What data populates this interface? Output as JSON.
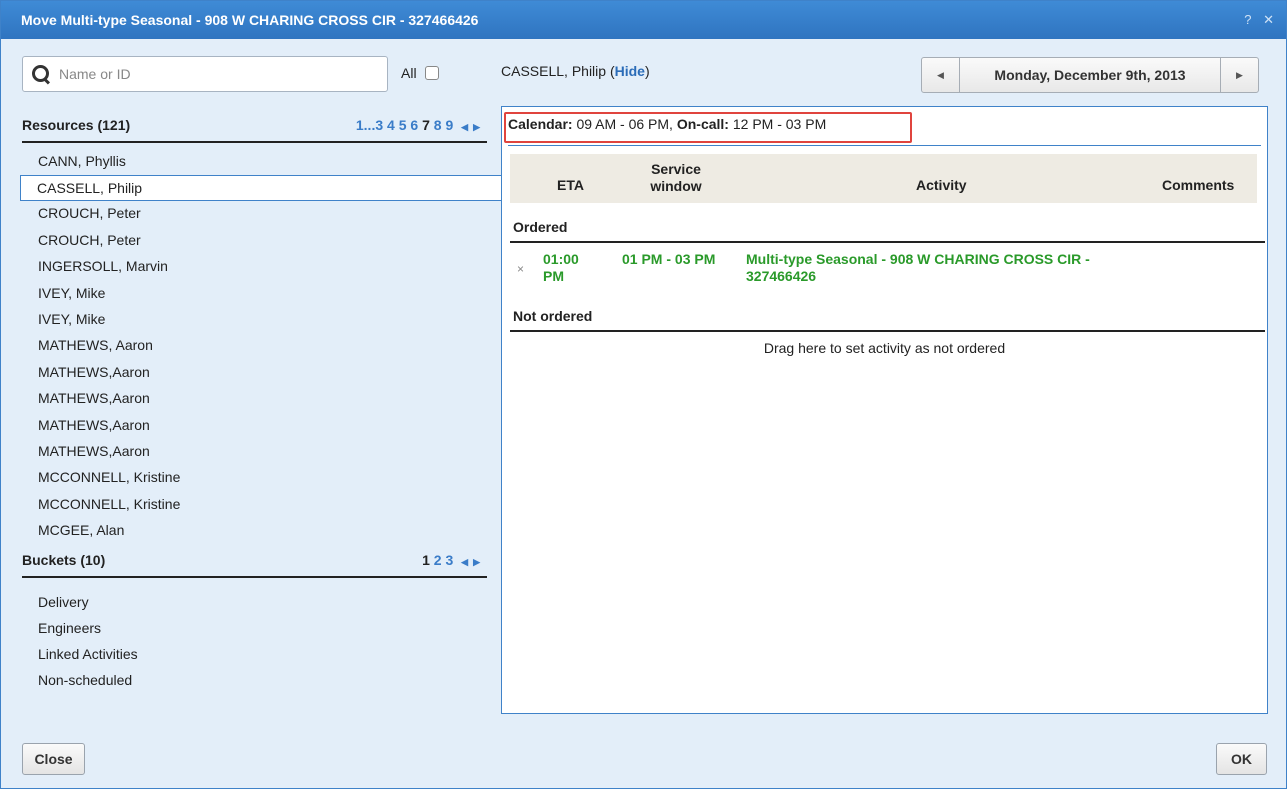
{
  "dialog": {
    "title": "Move Multi-type Seasonal - 908 W CHARING CROSS CIR - 327466426",
    "help_label": "?",
    "close_label": "✕"
  },
  "search": {
    "placeholder": "Name or ID",
    "value": "",
    "all_label": "All"
  },
  "resources": {
    "header": "Resources (121)",
    "pager": {
      "first": "1",
      "ellipsis": "...",
      "pages": [
        "3",
        "4",
        "5",
        "6",
        "7",
        "8",
        "9"
      ],
      "current": "7"
    },
    "items": [
      "CANN, Phyllis",
      "CASSELL, Philip",
      "CROUCH, Peter",
      "CROUCH, Peter",
      "INGERSOLL, Marvin",
      "IVEY, Mike",
      "IVEY, Mike",
      "MATHEWS, Aaron",
      "MATHEWS,Aaron",
      "MATHEWS,Aaron",
      "MATHEWS,Aaron",
      "MATHEWS,Aaron",
      "MCCONNELL, Kristine",
      "MCCONNELL, Kristine",
      "MCGEE, Alan"
    ],
    "selected": "CASSELL, Philip"
  },
  "buckets": {
    "header": "Buckets (10)",
    "pager": {
      "pages": [
        "1",
        "2",
        "3"
      ],
      "current": "1"
    },
    "items": [
      "Delivery",
      "Engineers",
      "Linked Activities",
      "Non-scheduled"
    ]
  },
  "resource_view": {
    "name": "CASSELL, Philip",
    "hide_prefix": "(",
    "hide_label": "Hide",
    "hide_suffix": ")",
    "date": "Monday, December 9th, 2013",
    "calendar_label": "Calendar:",
    "calendar_value": "09 AM - 06 PM,",
    "oncall_label": "On-call:",
    "oncall_value": "12 PM - 03 PM"
  },
  "table": {
    "col_eta": "ETA",
    "col_service_line1": "Service",
    "col_service_line2": "window",
    "col_activity": "Activity",
    "col_comments": "Comments",
    "ordered_label": "Ordered",
    "not_ordered_label": "Not ordered",
    "drop_hint": "Drag here to set activity as not ordered",
    "rows": [
      {
        "eta": "01:00 PM",
        "service_window": "01 PM - 03 PM",
        "activity": "Multi-type Seasonal - 908 W CHARING CROSS CIR - 327466426",
        "remove": "×"
      }
    ]
  },
  "buttons": {
    "close": "Close",
    "ok": "OK"
  },
  "colors": {
    "titlebar": "#3a82cf",
    "link": "#2b6cb8",
    "ordered_activity": "#2a9a2a",
    "highlight": "#e0443e"
  }
}
